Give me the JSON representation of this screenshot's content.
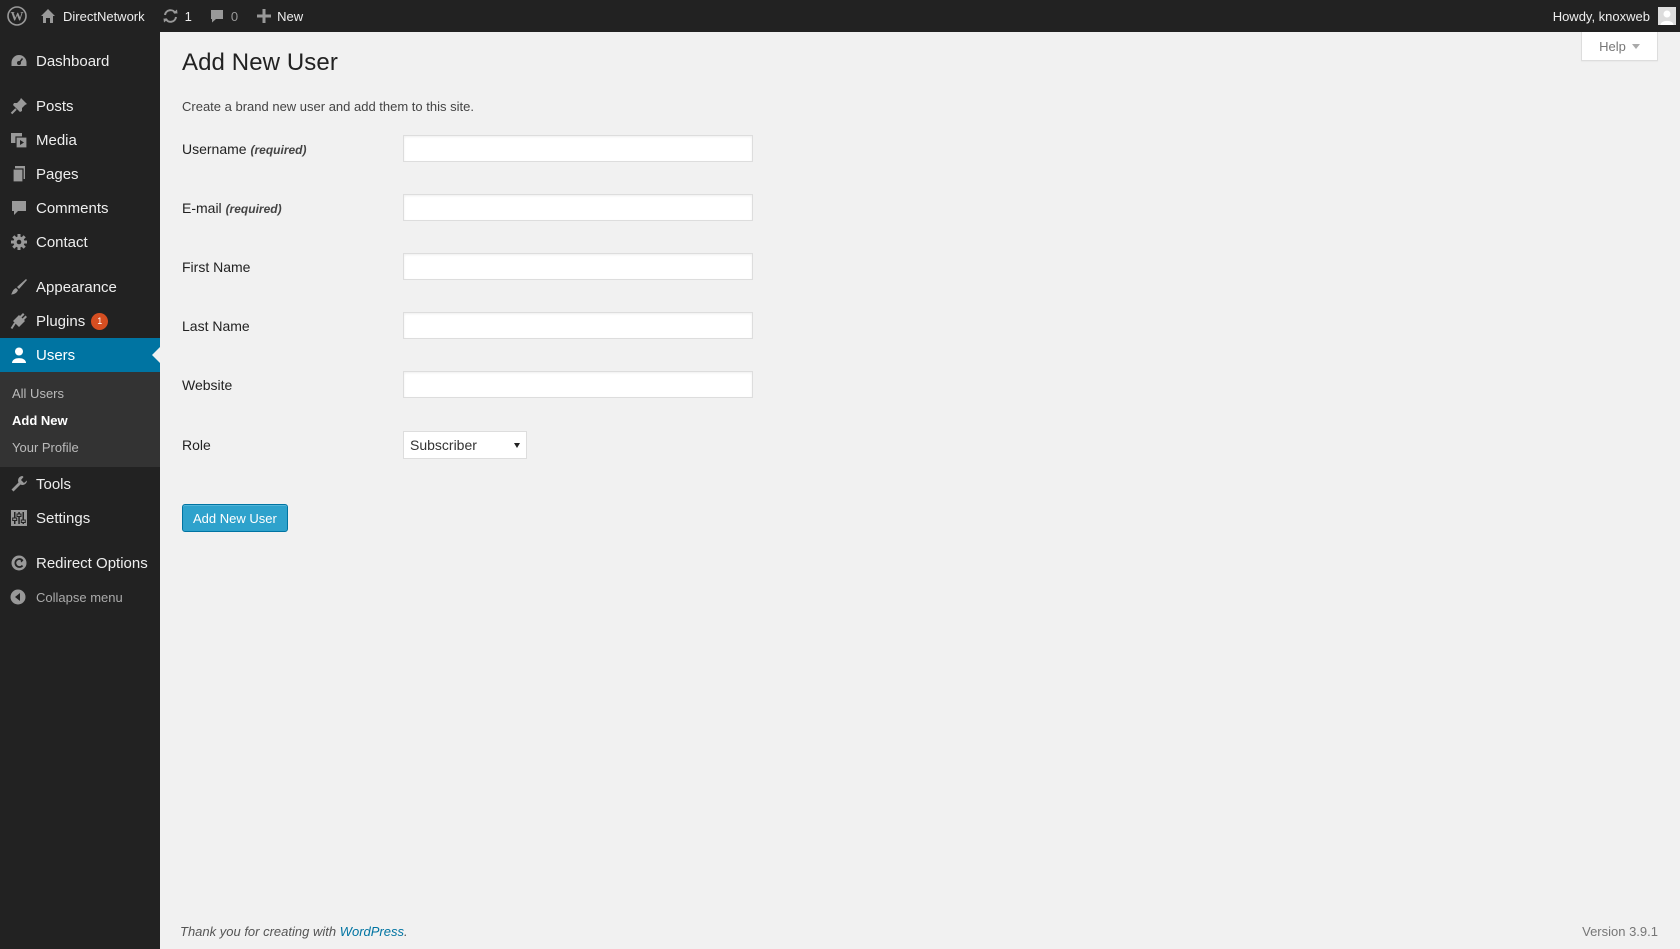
{
  "adminbar": {
    "wp_logo_icon": "wordpress-logo-icon",
    "site_name": "DirectNetwork",
    "updates_count": "1",
    "comments_count": "0",
    "new_label": "New",
    "account_label": "Howdy, knoxweb"
  },
  "sidebar": {
    "items": [
      {
        "label": "Dashboard",
        "icon": "dashboard-icon"
      },
      {
        "label": "Posts",
        "icon": "pin-icon"
      },
      {
        "label": "Media",
        "icon": "media-icon"
      },
      {
        "label": "Pages",
        "icon": "pages-icon"
      },
      {
        "label": "Comments",
        "icon": "comment-icon"
      },
      {
        "label": "Contact",
        "icon": "gear-icon"
      },
      {
        "label": "Appearance",
        "icon": "brush-icon"
      },
      {
        "label": "Plugins",
        "icon": "plug-icon",
        "badge": "1"
      },
      {
        "label": "Users",
        "icon": "user-icon"
      },
      {
        "label": "Tools",
        "icon": "wrench-icon"
      },
      {
        "label": "Settings",
        "icon": "settings-icon"
      },
      {
        "label": "Redirect Options",
        "icon": "redirect-icon"
      }
    ],
    "users_submenu": [
      "All Users",
      "Add New",
      "Your Profile"
    ],
    "collapse_label": "Collapse menu"
  },
  "help_tab": "Help",
  "page": {
    "title": "Add New User",
    "description": "Create a brand new user and add them to this site."
  },
  "form": {
    "username_label": "Username",
    "email_label": "E-mail",
    "required_text": "(required)",
    "first_name_label": "First Name",
    "last_name_label": "Last Name",
    "website_label": "Website",
    "role_label": "Role",
    "role_value": "Subscriber",
    "submit_label": "Add New User"
  },
  "footer": {
    "thanks_text": "Thank you for creating with ",
    "wordpress_link": "WordPress",
    "period": ".",
    "version": "Version 3.9.1"
  },
  "colors": {
    "adminbar_bg": "#222222",
    "current_menu": "#0074a2",
    "button": "#2ea2cc",
    "badge": "#d54e21"
  }
}
